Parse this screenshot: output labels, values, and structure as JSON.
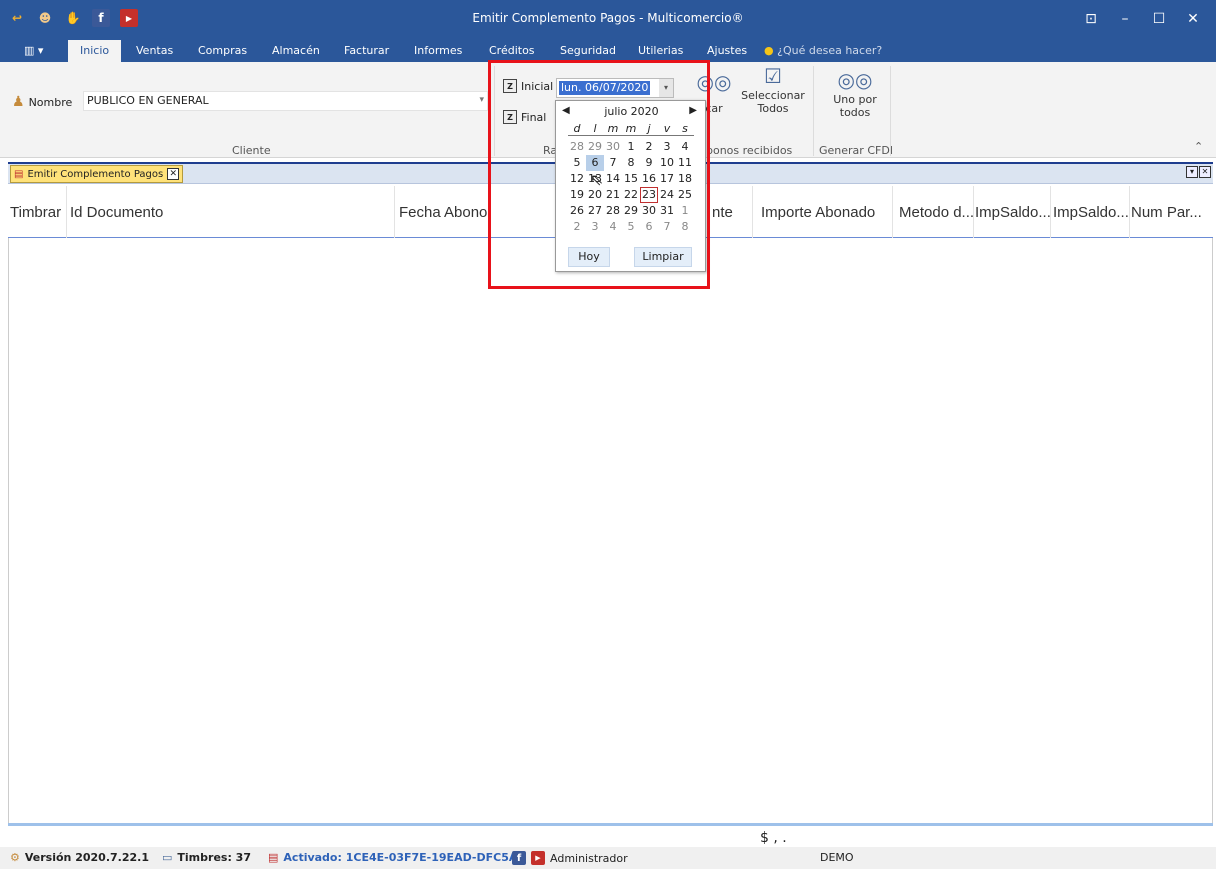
{
  "window": {
    "title": "Emitir Complemento Pagos - Multicomercio®"
  },
  "tabs": [
    "Inicio",
    "Ventas",
    "Compras",
    "Almacén",
    "Facturar",
    "Informes",
    "Créditos",
    "Seguridad",
    "Utilerias",
    "Ajustes"
  ],
  "search_hint": "¿Qué desea hacer?",
  "ribbon": {
    "nombre_label": "Nombre",
    "nombre_value": "PUBLICO EN GENERAL",
    "cliente_group": "Cliente",
    "inicial_label": "Inicial",
    "inicial_value": "lun. 06/07/2020",
    "final_label": "Final",
    "rango_group": "Ra",
    "buscar_label": "car",
    "seleccionar_label": "Seleccionar Todos",
    "abonos_group": "bonos recibidos",
    "uno_label": "Uno por todos",
    "generar_group": "Generar CFDI"
  },
  "doc_tab": "Emitir Complemento Pagos",
  "columns": [
    "Timbrar",
    "Id Documento",
    "Fecha Abono",
    "nte",
    "Importe Abonado",
    "Metodo d...",
    "ImpSaldo...",
    "ImpSaldo...",
    "Num Par..."
  ],
  "footer_total": "$ , .",
  "calendar": {
    "month": "julio 2020",
    "weekdays": [
      "d",
      "l",
      "m",
      "m",
      "j",
      "v",
      "s"
    ],
    "weeks": [
      [
        "28",
        "29",
        "30",
        "1",
        "2",
        "3",
        "4"
      ],
      [
        "5",
        "6",
        "7",
        "8",
        "9",
        "10",
        "11"
      ],
      [
        "12",
        "13",
        "14",
        "15",
        "16",
        "17",
        "18"
      ],
      [
        "19",
        "20",
        "21",
        "22",
        "23",
        "24",
        "25"
      ],
      [
        "26",
        "27",
        "28",
        "29",
        "30",
        "31",
        "1"
      ],
      [
        "2",
        "3",
        "4",
        "5",
        "6",
        "7",
        "8"
      ]
    ],
    "hoy": "Hoy",
    "limpiar": "Limpiar"
  },
  "status": {
    "version": "Versión 2020.7.22.1",
    "timbres": "Timbres: 37",
    "activado": "Activado: 1CE4E-03F7E-19EAD-DFC5A",
    "user": "Administrador",
    "mode": "DEMO"
  },
  "colors": {
    "title_bar": "#2b579a",
    "highlight": "#e8121a",
    "accent": "#3b6fd0"
  }
}
